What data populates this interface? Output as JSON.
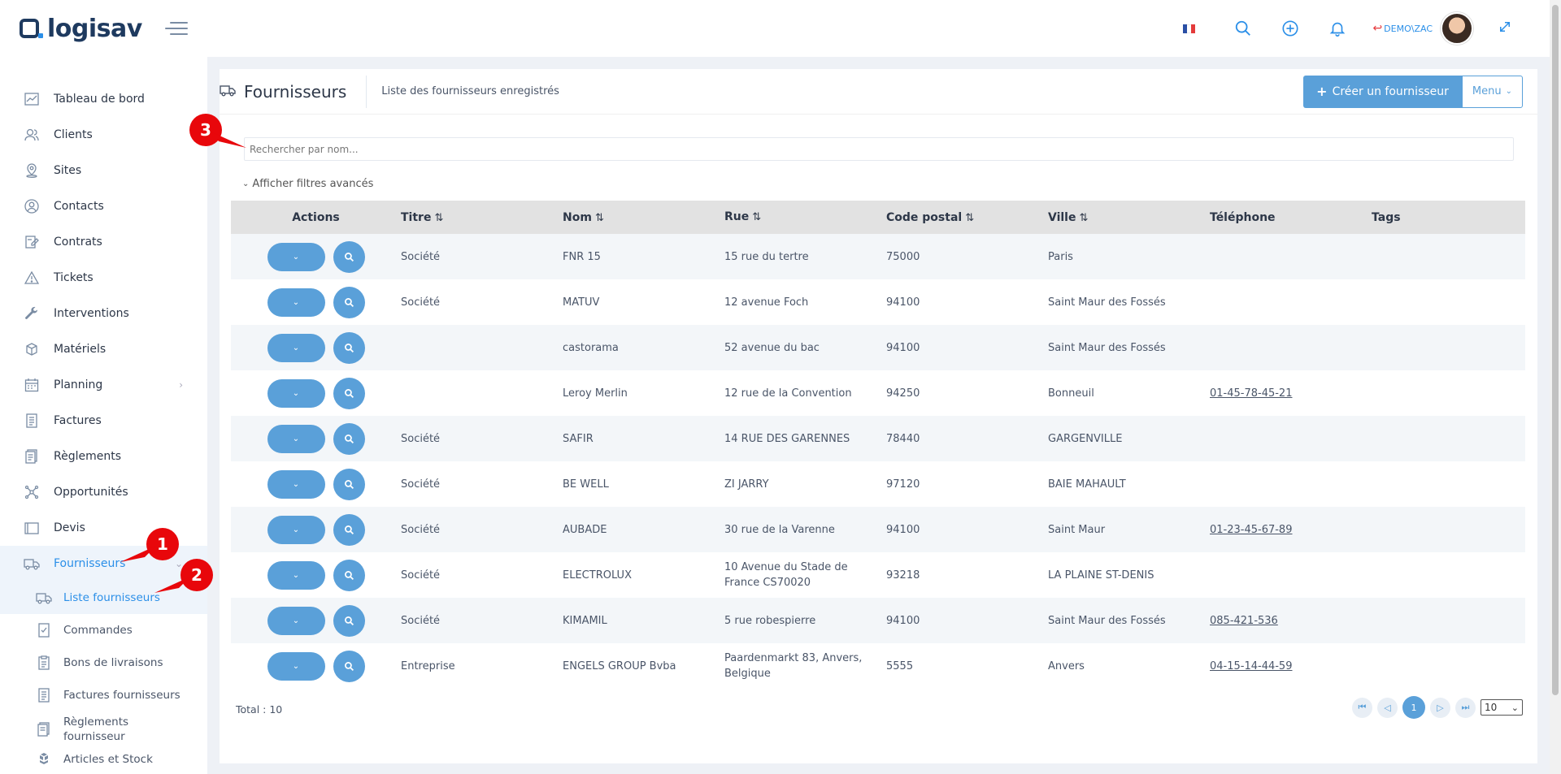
{
  "app": {
    "logo_text": "logisav",
    "brand_color": "#1e3a5f",
    "accent_color": "#5aa0d9"
  },
  "topbar": {
    "flag_icon": "french-flag-icon",
    "user_context": "DEMO\\ZAC"
  },
  "sidebar": {
    "items": [
      {
        "label": "Tableau de bord",
        "icon": "chart-icon"
      },
      {
        "label": "Clients",
        "icon": "users-icon"
      },
      {
        "label": "Sites",
        "icon": "location-pin-icon"
      },
      {
        "label": "Contacts",
        "icon": "contact-icon"
      },
      {
        "label": "Contrats",
        "icon": "contract-icon"
      },
      {
        "label": "Tickets",
        "icon": "warning-icon"
      },
      {
        "label": "Interventions",
        "icon": "wrench-icon"
      },
      {
        "label": "Matériels",
        "icon": "box-icon"
      },
      {
        "label": "Planning",
        "icon": "calendar-icon"
      },
      {
        "label": "Factures",
        "icon": "invoice-icon"
      },
      {
        "label": "Règlements",
        "icon": "payment-icon"
      },
      {
        "label": "Opportunités",
        "icon": "network-icon"
      },
      {
        "label": "Devis",
        "icon": "quote-icon"
      },
      {
        "label": "Fournisseurs",
        "icon": "truck-icon"
      }
    ],
    "sub_items": [
      {
        "label": "Liste fournisseurs",
        "icon": "truck-icon"
      },
      {
        "label": "Commandes",
        "icon": "order-icon"
      },
      {
        "label": "Bons de livraisons",
        "icon": "delivery-note-icon"
      },
      {
        "label": "Factures fournisseurs",
        "icon": "invoice-icon"
      },
      {
        "label_line1": "Règlements",
        "label_line2": "fournisseur",
        "icon": "payment-icon"
      },
      {
        "label": "Articles et Stock",
        "icon": "boxes-icon"
      }
    ]
  },
  "callouts": {
    "one": "1",
    "two": "2",
    "three": "3",
    "color": "#e8070b"
  },
  "page": {
    "title": "Fournisseurs",
    "subtitle": "Liste des fournisseurs enregistrés",
    "create_label": "Créer un fournisseur",
    "menu_label": "Menu",
    "search_placeholder": "Rechercher par nom...",
    "advanced_filters": "Afficher filtres avancés"
  },
  "table": {
    "headers": {
      "actions": "Actions",
      "titre": "Titre",
      "nom": "Nom",
      "rue": "Rue",
      "cp": "Code postal",
      "ville": "Ville",
      "tel": "Téléphone",
      "tags": "Tags"
    },
    "rows": [
      {
        "titre": "Société",
        "nom": "FNR 15",
        "rue": "15 rue du tertre",
        "cp": "75000",
        "ville": "Paris",
        "tel": ""
      },
      {
        "titre": "Société",
        "nom": "MATUV",
        "rue": "12 avenue Foch",
        "cp": "94100",
        "ville": "Saint Maur des Fossés",
        "tel": ""
      },
      {
        "titre": "",
        "nom": "castorama",
        "rue": "52 avenue du bac",
        "cp": "94100",
        "ville": "Saint Maur des Fossés",
        "tel": ""
      },
      {
        "titre": "",
        "nom": "Leroy Merlin",
        "rue": "12 rue de la Convention",
        "cp": "94250",
        "ville": "Bonneuil",
        "tel": "01-45-78-45-21"
      },
      {
        "titre": "Société",
        "nom": "SAFIR",
        "rue": "14 RUE DES GARENNES",
        "cp": "78440",
        "ville": "GARGENVILLE",
        "tel": ""
      },
      {
        "titre": "Société",
        "nom": "BE WELL",
        "rue": "ZI JARRY",
        "cp": "97120",
        "ville": "BAIE MAHAULT",
        "tel": ""
      },
      {
        "titre": "Société",
        "nom": "AUBADE",
        "rue": "30 rue de la Varenne",
        "cp": "94100",
        "ville": "Saint Maur",
        "tel": "01-23-45-67-89"
      },
      {
        "titre": "Société",
        "nom": "ELECTROLUX",
        "rue": "10 Avenue du Stade de France CS70020",
        "cp": "93218",
        "ville": "LA PLAINE ST-DENIS",
        "tel": ""
      },
      {
        "titre": "Société",
        "nom": "KIMAMIL",
        "rue": "5 rue robespierre",
        "cp": "94100",
        "ville": "Saint Maur des Fossés",
        "tel": "085-421-536"
      },
      {
        "titre": "Entreprise",
        "nom": "ENGELS GROUP Bvba",
        "rue": "Paardenmarkt 83, Anvers, Belgique",
        "cp": "5555",
        "ville": "Anvers",
        "tel": "04-15-14-44-59"
      }
    ]
  },
  "footer": {
    "total": "Total : 10",
    "current_page": "1",
    "per_page": "10"
  }
}
